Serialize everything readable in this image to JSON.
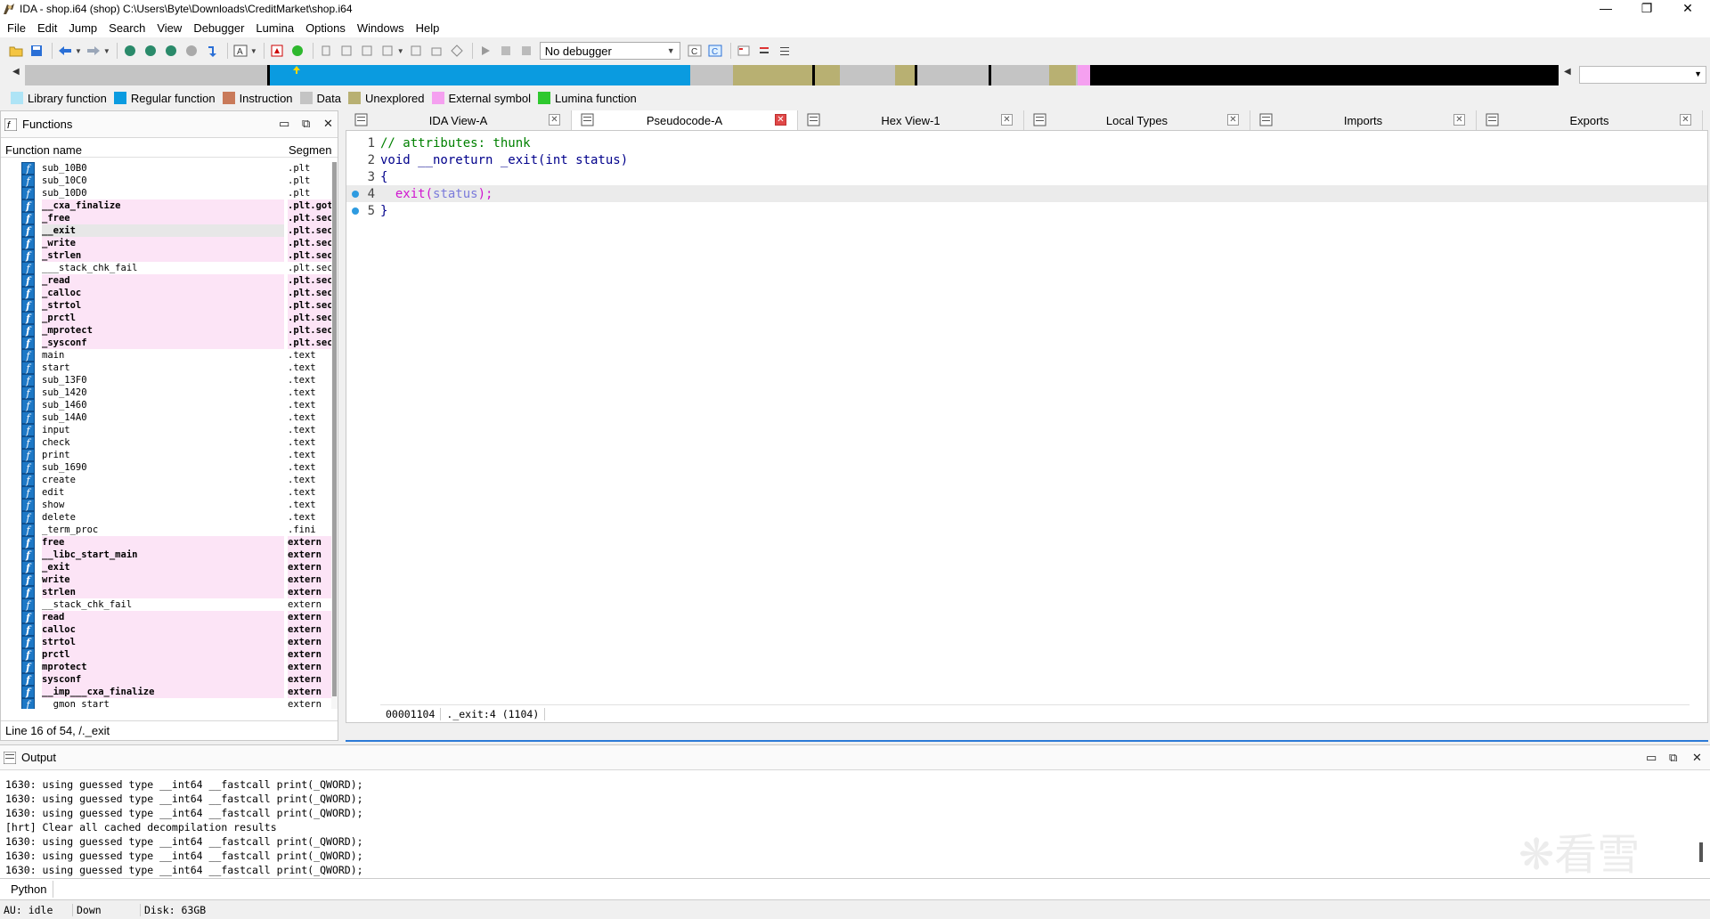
{
  "window": {
    "title": "IDA - shop.i64 (shop) C:\\Users\\Byte\\Downloads\\CreditMarket\\shop.i64",
    "controls": [
      "—",
      "❐",
      "✕"
    ]
  },
  "menu": [
    "File",
    "Edit",
    "Jump",
    "Search",
    "View",
    "Debugger",
    "Lumina",
    "Options",
    "Windows",
    "Help"
  ],
  "toolbar": {
    "debugger_select": "No debugger"
  },
  "legend": [
    {
      "label": "Library function",
      "color": "#aee4f6"
    },
    {
      "label": "Regular function",
      "color": "#0a9be0"
    },
    {
      "label": "Instruction",
      "color": "#c97a5a"
    },
    {
      "label": "Data",
      "color": "#c4c4c4"
    },
    {
      "label": "Unexplored",
      "color": "#b8b072"
    },
    {
      "label": "External symbol",
      "color": "#f5a0f0"
    },
    {
      "label": "Lumina function",
      "color": "#2ec82e"
    }
  ],
  "functions": {
    "title": "Functions",
    "col_name": "Function name",
    "col_segment": "Segmen",
    "status": "Line 16 of 54, /._exit",
    "rows": [
      {
        "name": "sub_10B0",
        "seg": ".plt",
        "lib": false
      },
      {
        "name": "sub_10C0",
        "seg": ".plt",
        "lib": false
      },
      {
        "name": "sub_10D0",
        "seg": ".plt",
        "lib": false
      },
      {
        "name": "__cxa_finalize",
        "seg": ".plt.got",
        "lib": true
      },
      {
        "name": "_free",
        "seg": ".plt.sec",
        "lib": true
      },
      {
        "name": "__exit",
        "seg": ".plt.sec",
        "lib": true,
        "sel": true
      },
      {
        "name": "_write",
        "seg": ".plt.sec",
        "lib": true
      },
      {
        "name": "_strlen",
        "seg": ".plt.sec",
        "lib": true
      },
      {
        "name": "___stack_chk_fail",
        "seg": ".plt.sec",
        "lib": false
      },
      {
        "name": "_read",
        "seg": ".plt.sec",
        "lib": true
      },
      {
        "name": "_calloc",
        "seg": ".plt.sec",
        "lib": true
      },
      {
        "name": "_strtol",
        "seg": ".plt.sec",
        "lib": true
      },
      {
        "name": "_prctl",
        "seg": ".plt.sec",
        "lib": true
      },
      {
        "name": "_mprotect",
        "seg": ".plt.sec",
        "lib": true
      },
      {
        "name": "_sysconf",
        "seg": ".plt.sec",
        "lib": true
      },
      {
        "name": "main",
        "seg": ".text",
        "lib": false
      },
      {
        "name": "start",
        "seg": ".text",
        "lib": false
      },
      {
        "name": "sub_13F0",
        "seg": ".text",
        "lib": false
      },
      {
        "name": "sub_1420",
        "seg": ".text",
        "lib": false
      },
      {
        "name": "sub_1460",
        "seg": ".text",
        "lib": false
      },
      {
        "name": "sub_14A0",
        "seg": ".text",
        "lib": false
      },
      {
        "name": "input",
        "seg": ".text",
        "lib": false
      },
      {
        "name": "check",
        "seg": ".text",
        "lib": false
      },
      {
        "name": "print",
        "seg": ".text",
        "lib": false
      },
      {
        "name": "sub_1690",
        "seg": ".text",
        "lib": false
      },
      {
        "name": "create",
        "seg": ".text",
        "lib": false
      },
      {
        "name": "edit",
        "seg": ".text",
        "lib": false
      },
      {
        "name": "show",
        "seg": ".text",
        "lib": false
      },
      {
        "name": "delete",
        "seg": ".text",
        "lib": false
      },
      {
        "name": "_term_proc",
        "seg": ".fini",
        "lib": false
      },
      {
        "name": "free",
        "seg": "extern",
        "lib": true
      },
      {
        "name": "__libc_start_main",
        "seg": "extern",
        "lib": true
      },
      {
        "name": "_exit",
        "seg": "extern",
        "lib": true
      },
      {
        "name": "write",
        "seg": "extern",
        "lib": true
      },
      {
        "name": "strlen",
        "seg": "extern",
        "lib": true
      },
      {
        "name": "__stack_chk_fail",
        "seg": "extern",
        "lib": false
      },
      {
        "name": "read",
        "seg": "extern",
        "lib": true
      },
      {
        "name": "calloc",
        "seg": "extern",
        "lib": true
      },
      {
        "name": "strtol",
        "seg": "extern",
        "lib": true
      },
      {
        "name": "prctl",
        "seg": "extern",
        "lib": true
      },
      {
        "name": "mprotect",
        "seg": "extern",
        "lib": true
      },
      {
        "name": "sysconf",
        "seg": "extern",
        "lib": true
      },
      {
        "name": "__imp___cxa_finalize",
        "seg": "extern",
        "lib": true
      },
      {
        "name": "__gmon_start__",
        "seg": "extern",
        "lib": false
      }
    ]
  },
  "tabs": [
    {
      "label": "IDA View-A",
      "active": false
    },
    {
      "label": "Pseudocode-A",
      "active": true
    },
    {
      "label": "Hex View-1",
      "active": false
    },
    {
      "label": "Local Types",
      "active": false
    },
    {
      "label": "Imports",
      "active": false
    },
    {
      "label": "Exports",
      "active": false
    }
  ],
  "code": {
    "lines": [
      {
        "num": "1",
        "parts": [
          {
            "t": "// attributes: thunk",
            "c": "c-comment"
          }
        ],
        "bp": false,
        "hl": false
      },
      {
        "num": "2",
        "parts": [
          {
            "t": "void __noreturn _exit(int status)",
            "c": "c-code"
          }
        ],
        "bp": false,
        "hl": false
      },
      {
        "num": "3",
        "parts": [
          {
            "t": "{",
            "c": "c-code"
          }
        ],
        "bp": false,
        "hl": false
      },
      {
        "num": "4",
        "parts": [
          {
            "t": "  ",
            "c": "c-code"
          },
          {
            "t": "exit",
            "c": "c-fn"
          },
          {
            "t": "(",
            "c": "c-fn"
          },
          {
            "t": "status",
            "c": "c-arg"
          },
          {
            "t": ");",
            "c": "c-fn"
          }
        ],
        "bp": true,
        "hl": true
      },
      {
        "num": "5",
        "parts": [
          {
            "t": "}",
            "c": "c-code"
          }
        ],
        "bp": true,
        "hl": false
      }
    ],
    "status_addr": "00001104",
    "status_loc": "._exit:4 (1104)"
  },
  "output": {
    "title": "Output",
    "lines": [
      "1630: using guessed type __int64 __fastcall print(_QWORD);",
      "1630: using guessed type __int64 __fastcall print(_QWORD);",
      "1630: using guessed type __int64 __fastcall print(_QWORD);",
      "[hrt] Clear all cached decompilation results",
      "1630: using guessed type __int64 __fastcall print(_QWORD);",
      "1630: using guessed type __int64 __fastcall print(_QWORD);",
      "1630: using guessed type __int64 __fastcall print(_QWORD);"
    ],
    "watermark": "❋看雪",
    "python_label": "Python"
  },
  "statusbar": {
    "au": "AU:  idle",
    "dir": "Down",
    "disk": "Disk: 63GB"
  }
}
